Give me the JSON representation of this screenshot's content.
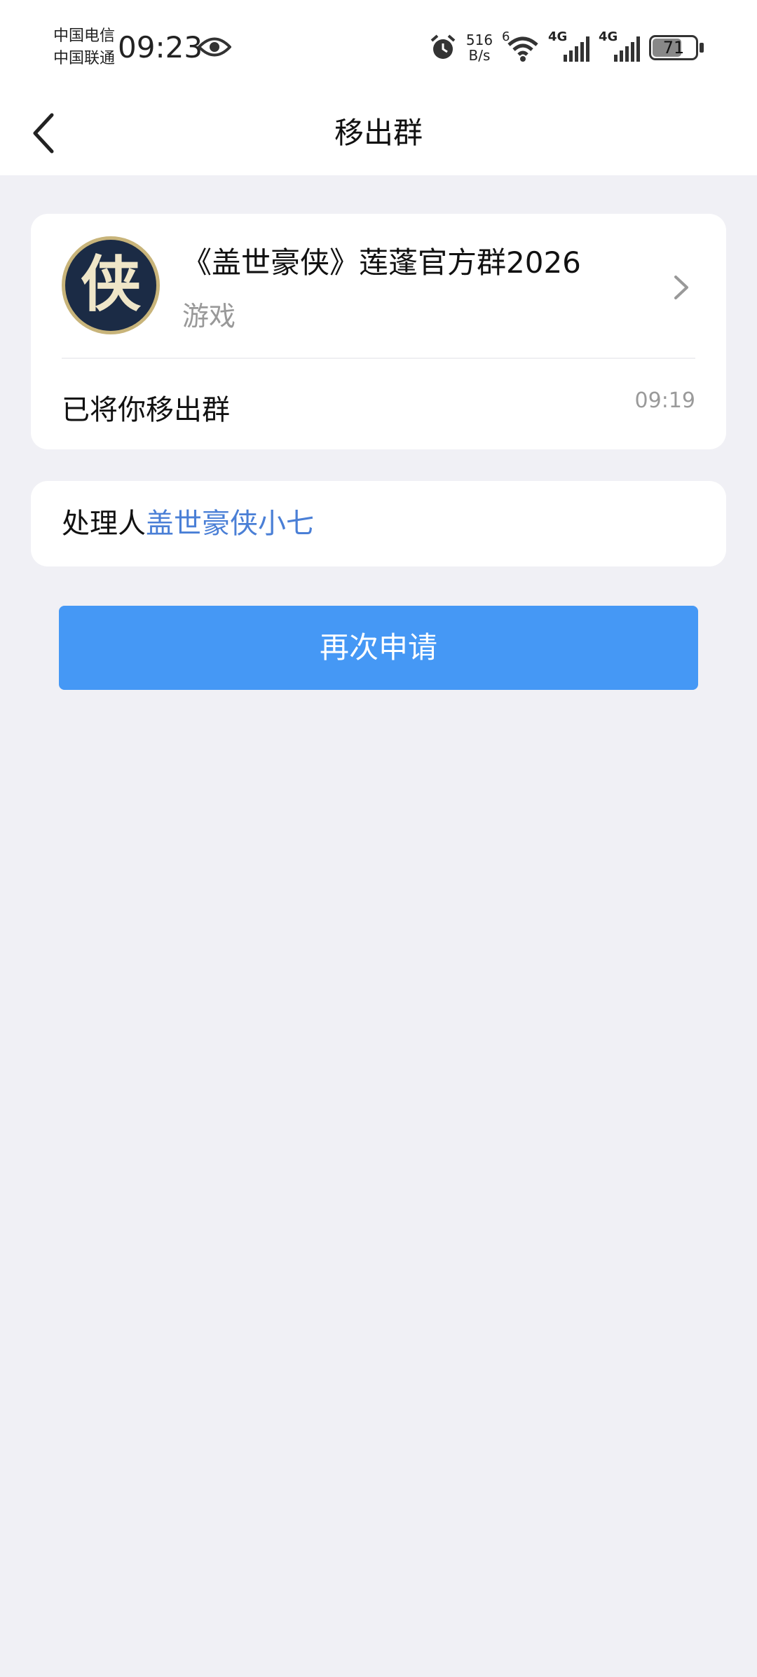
{
  "status_bar": {
    "carrier_1": "中国电信",
    "carrier_2": "中国联通",
    "time": "09:23",
    "net_speed_value": "516",
    "net_speed_unit": "B/s",
    "wifi_badge": "6",
    "sim1_label": "4G",
    "sim2_label": "4G",
    "battery": "71",
    "battery_level_percent": 71
  },
  "nav": {
    "title": "移出群"
  },
  "group": {
    "avatar_glyph": "侠",
    "name": "《盖世豪侠》莲蓬官方群2026",
    "category": "游戏",
    "notice": "已将你移出群",
    "notice_time": "09:19"
  },
  "handler": {
    "label": "处理人",
    "name": "盖世豪侠小七"
  },
  "actions": {
    "reapply_label": "再次申请"
  },
  "colors": {
    "background": "#f0f0f5",
    "primary_button": "#4598f5",
    "link": "#4a7fd6",
    "secondary_text": "#999999"
  }
}
